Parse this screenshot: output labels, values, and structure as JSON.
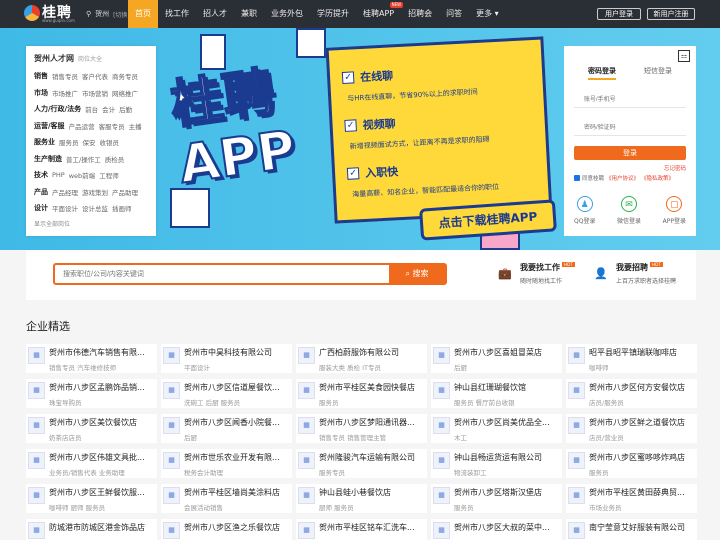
{
  "header": {
    "logo_text": "桂聘",
    "logo_url": "www.guipin.com",
    "city": "贺州",
    "switch": "[切换]",
    "nav": [
      "首页",
      "找工作",
      "招人才",
      "兼职",
      "业务外包",
      "学历提升",
      "桂聘APP",
      "招聘会",
      "问答",
      "更多 ▾"
    ],
    "app_badge": "NEW",
    "login": "用户登录",
    "register": "新用户注册"
  },
  "categories": {
    "title": "贺州人才网",
    "subtitle": "岗位大全",
    "rows": [
      {
        "main": "销售",
        "links": [
          "销售专员",
          "客户代表",
          "商务专员"
        ]
      },
      {
        "main": "市场",
        "links": [
          "市场推广",
          "市场营销",
          "网络推广"
        ]
      },
      {
        "main": "人力/行政/法务",
        "links": [
          "前台",
          "会计",
          "后勤"
        ]
      },
      {
        "main": "运营/客服",
        "links": [
          "产品运营",
          "客服专员",
          "主播"
        ]
      },
      {
        "main": "服务业",
        "links": [
          "服务员",
          "保安",
          "收银员"
        ]
      },
      {
        "main": "生产制造",
        "links": [
          "普工/操作工",
          "质检员"
        ]
      },
      {
        "main": "技术",
        "links": [
          "PHP",
          "web前端",
          "工程师"
        ]
      },
      {
        "main": "产品",
        "links": [
          "产品经理",
          "游戏策划",
          "产品助理"
        ]
      },
      {
        "main": "设计",
        "links": [
          "平面设计",
          "设计总监",
          "插画师"
        ]
      }
    ],
    "all": "显示全部岗位"
  },
  "banner": {
    "title_line1": "桂聘",
    "title_line2": "APP",
    "features": [
      {
        "h": "在线聊",
        "d": "与HR在线直聊，节省90%以上的求职时间"
      },
      {
        "h": "视频聊",
        "d": "新增视频面试方式，让距离不再是求职的阻碍"
      },
      {
        "h": "入职快",
        "d": "海量高薪、知名企业，智能匹配最适合你的职位"
      }
    ],
    "download": "点击下载桂聘APP"
  },
  "login": {
    "qr": "⚏",
    "tab_password": "密码登录",
    "tab_sms": "短信登录",
    "ph_user": "账号/手机号",
    "ph_pwd": "密码/验证码",
    "btn": "登录",
    "forget": "忘记密码",
    "agree": "同意桂聘",
    "agree_link1": "《用户协议》",
    "agree_link2": "《隐私政策》",
    "oauth": [
      {
        "name": "QQ登录",
        "icon": "qq-icon",
        "glyph": "♟",
        "color": "#3aa0e4"
      },
      {
        "name": "微信登录",
        "icon": "wechat-icon",
        "glyph": "✉",
        "color": "#2bb24c"
      },
      {
        "name": "APP登录",
        "icon": "app-icon",
        "glyph": "▢",
        "color": "#f06a1d"
      }
    ]
  },
  "search": {
    "placeholder": "搜索职位/公司/内容关键词",
    "btn": "搜索"
  },
  "quick": [
    {
      "title": "我要找工作",
      "desc": "随时随地找工作",
      "badge": "HOT",
      "icon": "briefcase-icon",
      "glyph": "💼"
    },
    {
      "title": "我要招聘",
      "desc": "上百万求职者选择桂聘",
      "badge": "HOT",
      "icon": "user-icon",
      "glyph": "👤"
    }
  ],
  "section_title": "企业精选",
  "companies": [
    {
      "name": "贺州市伟德汽车销售有限...",
      "tags": "销售专员  汽车维修技师"
    },
    {
      "name": "贺州市中昊科技有限公司",
      "tags": "平面设计"
    },
    {
      "name": "广西柏蔚服饰有限公司",
      "tags": "服装大类  质检  IT专员"
    },
    {
      "name": "贺州市八步区喜姐冒菜店",
      "tags": "后厨"
    },
    {
      "name": "昭平县昭平镇瑞联咖啡店",
      "tags": "咖啡师"
    },
    {
      "name": "贺州市八步区孟鹏饰品销...",
      "tags": "珠宝导购员"
    },
    {
      "name": "贺州市八步区信道屋餐饮...",
      "tags": "洗碗工  后厨  服务员"
    },
    {
      "name": "贺州市平桂区美食园快餐店",
      "tags": "服务员"
    },
    {
      "name": "钟山县红珊瑚餐饮馆",
      "tags": "服务员  餐厅前台收银"
    },
    {
      "name": "贺州市八步区何方安餐饮店",
      "tags": "店员/服务员"
    },
    {
      "name": "贺州市八步区美饮餐饮店",
      "tags": "奶茶店店员"
    },
    {
      "name": "贺州市八步区闻香小院餐...",
      "tags": "后厨"
    },
    {
      "name": "贺州市八步区梦阳通讯器...",
      "tags": "销售专员  销售管理主管"
    },
    {
      "name": "贺州市八步区尚美优品全...",
      "tags": "木工"
    },
    {
      "name": "贺州市八步区鲜之道餐饮店",
      "tags": "店员/营业员"
    },
    {
      "name": "贺州市八步区伟雄文具批...",
      "tags": "业务员/销售代表  业务助理"
    },
    {
      "name": "贺州市世乐农业开发有限...",
      "tags": "税务会计助理"
    },
    {
      "name": "贺州隆骏汽车运输有限公司",
      "tags": "服务专员"
    },
    {
      "name": "钟山县畅运货运有限公司",
      "tags": "物流装卸工"
    },
    {
      "name": "贺州市八步区蜜哆哆炸鸡店",
      "tags": "服务员"
    },
    {
      "name": "贺州市八步区王鲜餐饮服...",
      "tags": "咖啡师  厨师  服务员"
    },
    {
      "name": "贺州市平桂区墙尚美涂料店",
      "tags": "会展活动销售"
    },
    {
      "name": "钟山县蛙小巷餐饮店",
      "tags": "厨师  服务员"
    },
    {
      "name": "贺州市八步区塔斯汉堡店",
      "tags": "服务员"
    },
    {
      "name": "贺州市平桂区黄田薛典贸...",
      "tags": "市场业务员"
    },
    {
      "name": "防城港市防城区港金饰品店",
      "tags": ""
    },
    {
      "name": "贺州市八步区渔之乐餐饮店",
      "tags": ""
    },
    {
      "name": "贺州市平桂区铭车汇洗车...",
      "tags": ""
    },
    {
      "name": "贺州市八步区大叔的菜中...",
      "tags": ""
    },
    {
      "name": "南宁莹意艾好服装有限公司",
      "tags": ""
    }
  ]
}
